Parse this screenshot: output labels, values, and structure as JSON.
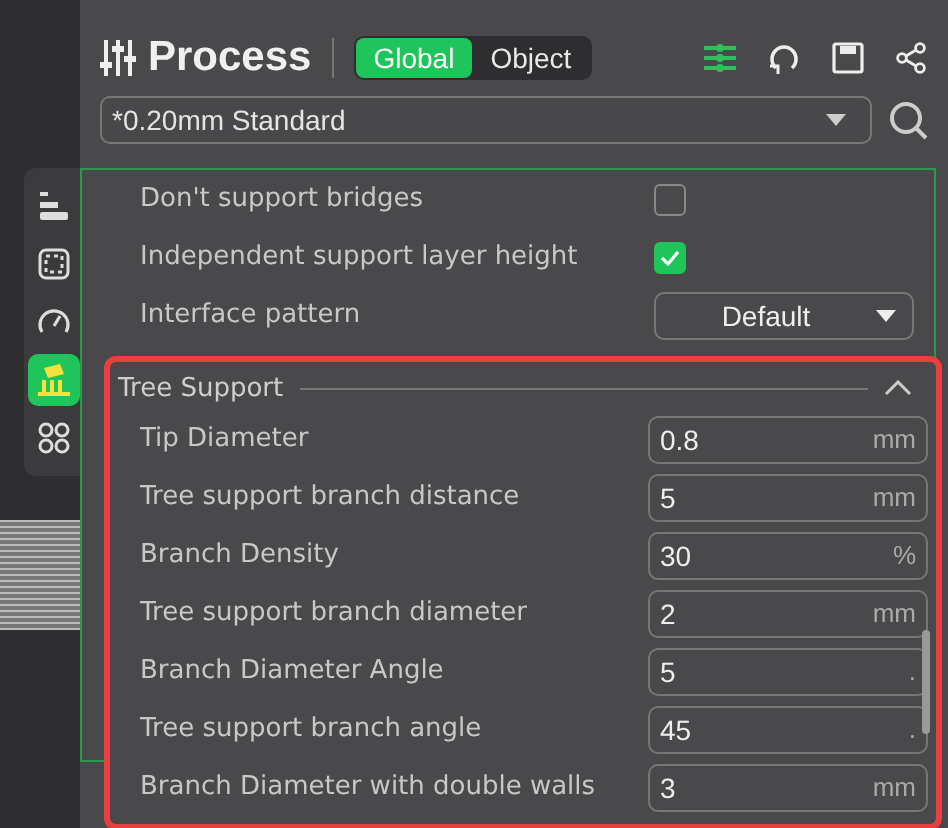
{
  "header": {
    "title": "Process",
    "scope_tabs": [
      {
        "label": "Global",
        "selected": true
      },
      {
        "label": "Object",
        "selected": false
      }
    ]
  },
  "preset": {
    "value": "*0.20mm Standard"
  },
  "sidebar_tabs": [
    {
      "selected": false
    },
    {
      "selected": false
    },
    {
      "selected": false
    },
    {
      "selected": true
    },
    {
      "selected": false
    }
  ],
  "settings": [
    {
      "kind": "checkbox",
      "label": "Don't support bridges",
      "checked": false
    },
    {
      "kind": "checkbox",
      "label": "Independent support layer height",
      "checked": true
    },
    {
      "kind": "dropdown",
      "label": "Interface pattern",
      "value": "Default"
    }
  ],
  "section": {
    "title": "Tree Support",
    "expanded": true,
    "items": [
      {
        "label": "Tip Diameter",
        "value": "0.8",
        "unit": "mm"
      },
      {
        "label": "Tree support branch distance",
        "value": "5",
        "unit": "mm"
      },
      {
        "label": "Branch Density",
        "value": "30",
        "unit": "%"
      },
      {
        "label": "Tree support branch diameter",
        "value": "2",
        "unit": "mm"
      },
      {
        "label": "Branch Diameter Angle",
        "value": "5",
        "unit": "."
      },
      {
        "label": "Tree support branch angle",
        "value": "45",
        "unit": "."
      },
      {
        "label": "Branch Diameter with double walls",
        "value": "3",
        "unit": "mm"
      }
    ]
  }
}
